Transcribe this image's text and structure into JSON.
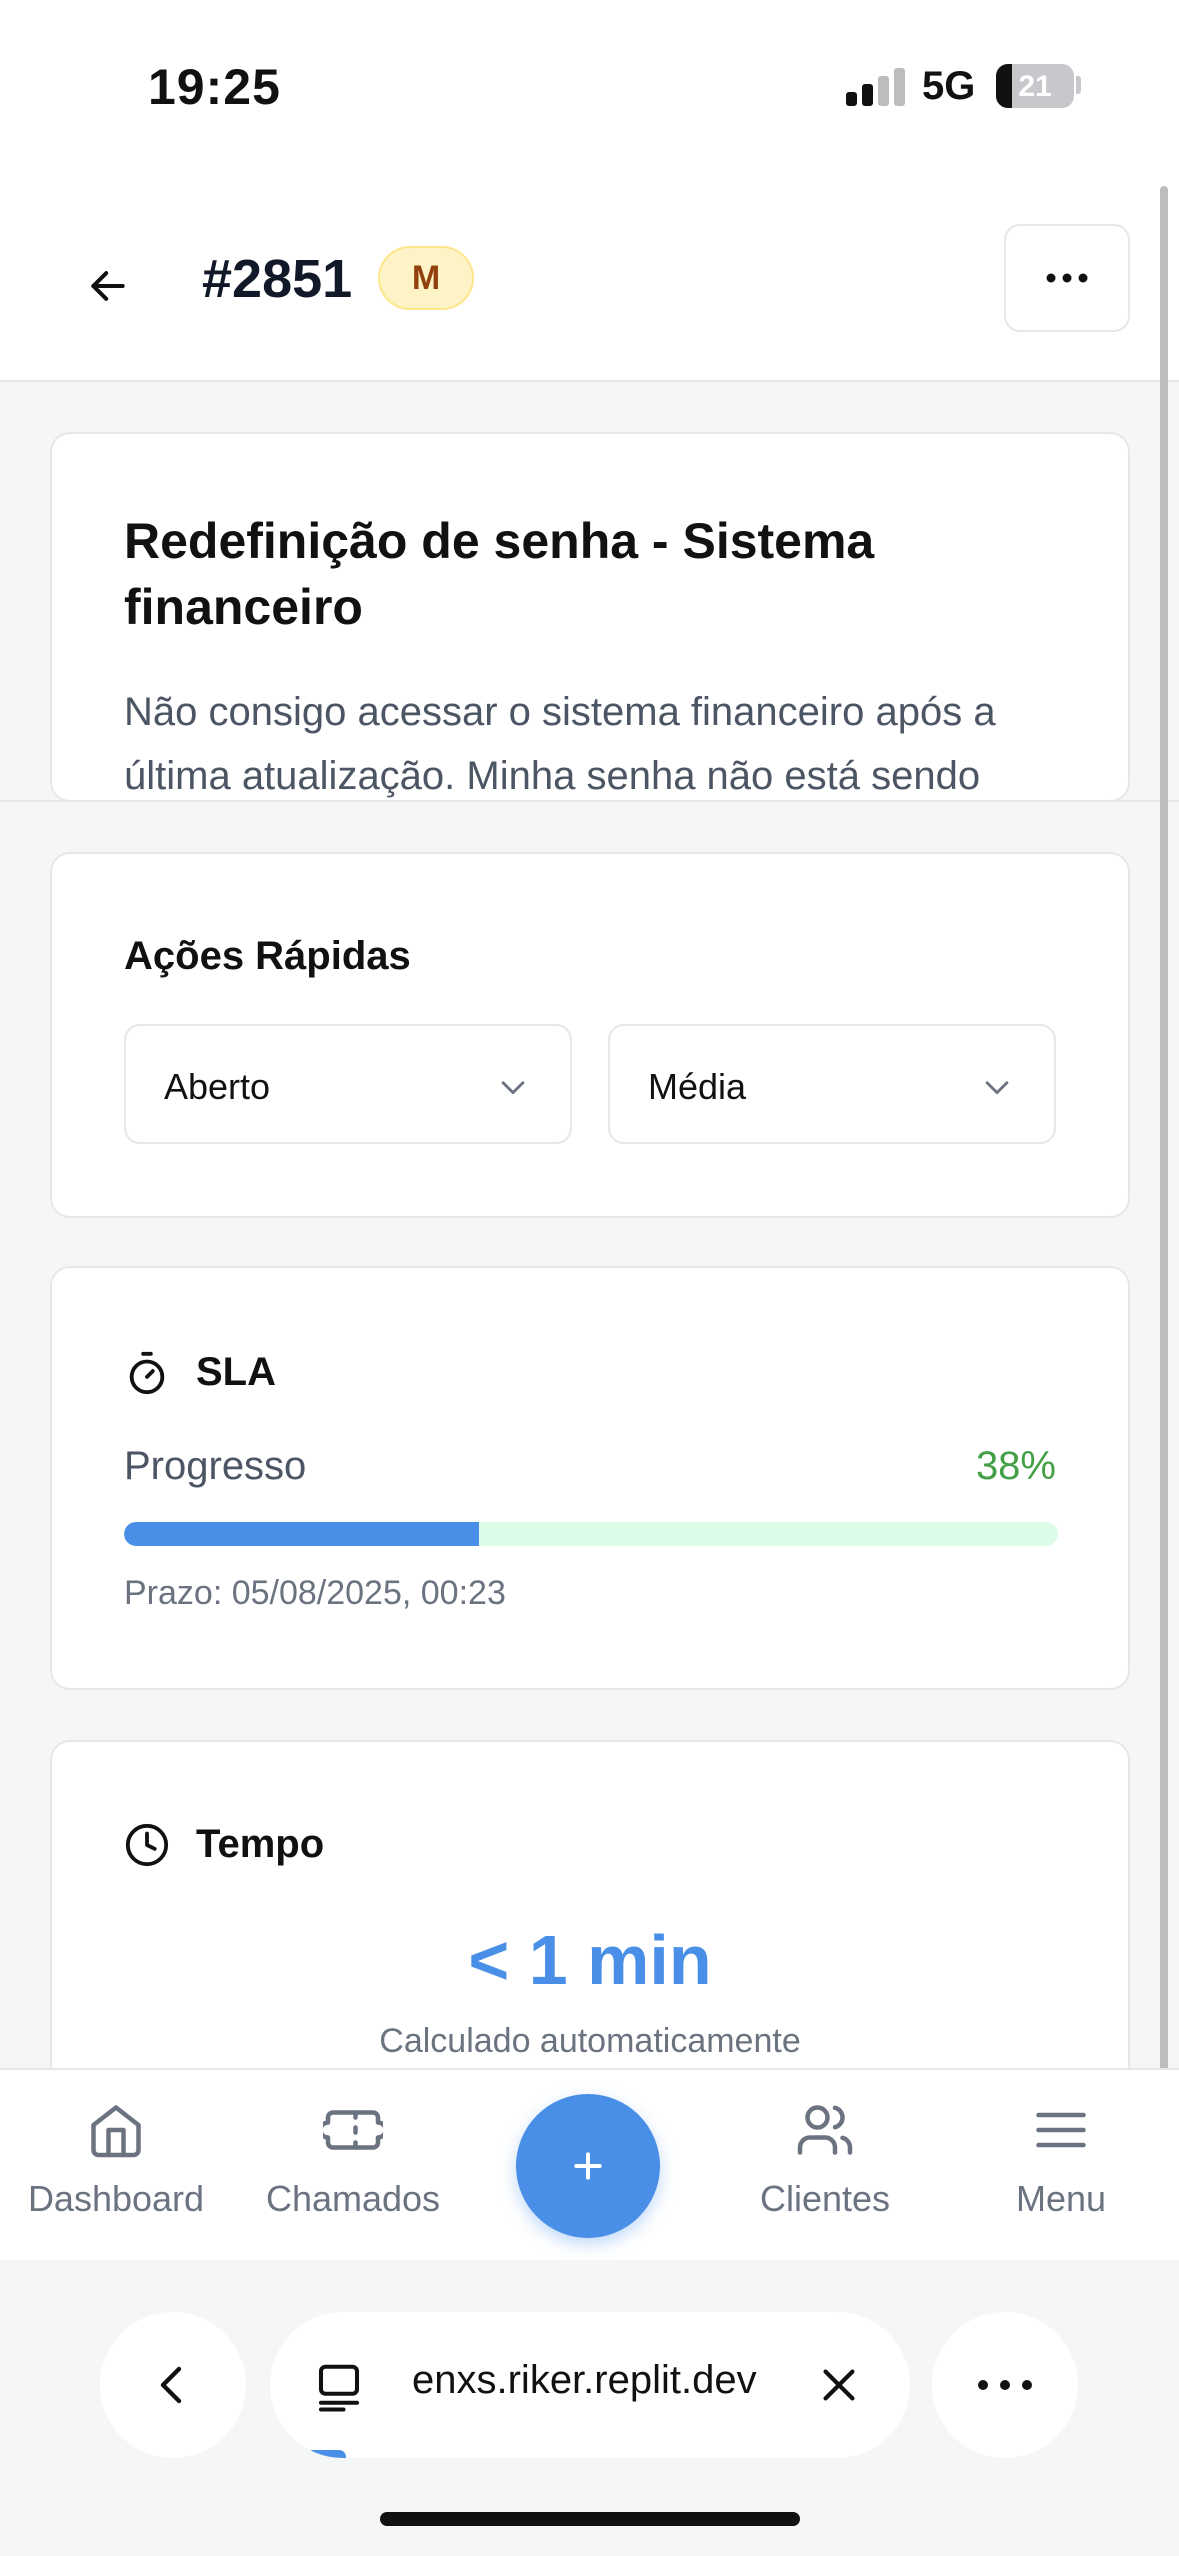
{
  "status_bar": {
    "time": "19:25",
    "network": "5G",
    "battery": "21",
    "battery_level_percent": 21,
    "signal_bars_active": 2,
    "signal_bars_total": 4
  },
  "header": {
    "ticket_id": "#2851",
    "priority_badge": "M",
    "back_icon": "arrow-left-icon",
    "more_icon": "ellipsis-icon"
  },
  "ticket": {
    "title": "Redefinição de senha - Sistema financeiro",
    "description": "Não consigo acessar o sistema financeiro após a última atualização. Minha senha não está sendo"
  },
  "quick_actions": {
    "title": "Ações Rápidas",
    "status_value": "Aberto",
    "priority_value": "Média"
  },
  "sla": {
    "title": "SLA",
    "progress_label": "Progresso",
    "progress_text": "38%",
    "progress_value": 38,
    "deadline": "Prazo: 05/08/2025, 00:23",
    "icon": "timer-icon"
  },
  "time": {
    "title": "Tempo",
    "value": "< 1 min",
    "note": "Calculado automaticamente",
    "icon": "clock-icon"
  },
  "bottom_nav": {
    "items": [
      {
        "label": "Dashboard",
        "icon": "home-icon"
      },
      {
        "label": "Chamados",
        "icon": "ticket-icon"
      },
      {
        "label": "Clientes",
        "icon": "users-icon"
      },
      {
        "label": "Menu",
        "icon": "menu-icon"
      }
    ],
    "fab_label": "+"
  },
  "browser": {
    "url": "enxs.riker.replit.dev"
  },
  "colors": {
    "accent": "#4a8fe7",
    "success": "#43a047",
    "badge_bg": "#fef3c7",
    "badge_text": "#92400e"
  }
}
